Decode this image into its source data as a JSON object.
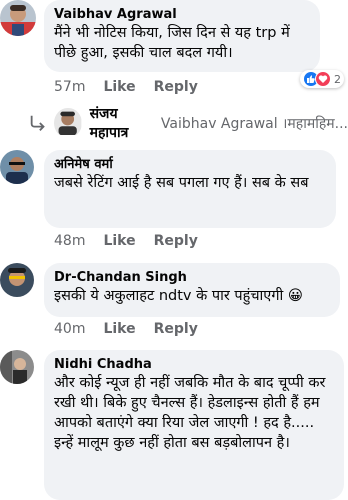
{
  "actions": {
    "like": "Like",
    "reply": "Reply"
  },
  "comments": [
    {
      "author": "Vaibhav Agrawal",
      "text": "मैंने भी नोटिस किया, जिस दिन से यह trp में पीछे हुआ, इसकी चाल बदल गयी।",
      "time": "57m",
      "reactions": {
        "icons": [
          "like-icon",
          "love-icon"
        ],
        "count": "2"
      }
    },
    {
      "author": "अनिमेष वर्मा",
      "text": "जबसे रेटिंग आई है सब पगला गए हैं। सब के सब",
      "time": "48m"
    },
    {
      "author": "Dr-Chandan Singh",
      "text": "इसकी ये अकुलाहट ndtv के पार पहुंचाएगी 😀",
      "time": "40m"
    },
    {
      "author": "Nidhi Chadha",
      "text": "और कोई न्यूज ही नहीं जबकि मौत के बाद चूप्पी कर रखी थी। बिके हुए चैनल्स हैं। हेडलाइन्स होती हैं हम आपको बताएंगे क्या रिया जेल जाएगी ! हद है..... इन्हें मालूम कुछ नहीं होता बस बड़बोलापन है।"
    }
  ],
  "reply_preview": {
    "author": "संजय महापात्र",
    "text": "Vaibhav Agrawal ।महामहिम..."
  },
  "colors": {
    "bubble": "#f0f2f5",
    "meta": "#65676b",
    "like_blue": "#1877f2",
    "love_red": "#f33e58"
  }
}
